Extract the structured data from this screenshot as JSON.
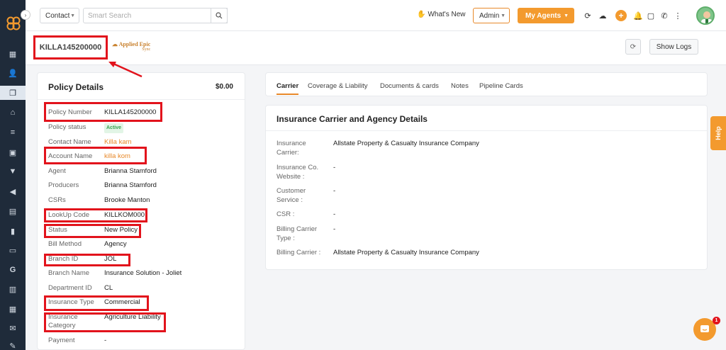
{
  "topbar": {
    "contact_select": "Contact",
    "search_placeholder": "Smart Search",
    "whats_new": "What's New",
    "admin": "Admin",
    "my_agents": "My Agents",
    "notification_count": ""
  },
  "header": {
    "policy_id": "KILLA145200000",
    "brand_name": "Applied Epic",
    "brand_sub": "Sync",
    "show_logs": "Show Logs"
  },
  "policy_details": {
    "title": "Policy Details",
    "amount": "$0.00",
    "fields": [
      {
        "label": "Policy Number",
        "value": "KILLA145200000"
      },
      {
        "label": "Policy status",
        "value": "Active"
      },
      {
        "label": "Contact Name",
        "value": "Killa kam"
      },
      {
        "label": "Account Name",
        "value": "killa kom"
      },
      {
        "label": "Agent",
        "value": "Brianna Stamford"
      },
      {
        "label": "Producers",
        "value": "Brianna Stamford"
      },
      {
        "label": "CSRs",
        "value": "Brooke Manton"
      },
      {
        "label": "LookUp Code",
        "value": "KILLKOM000"
      },
      {
        "label": "Status",
        "value": "New Policy"
      },
      {
        "label": "Bill Method",
        "value": "Agency"
      },
      {
        "label": "Branch ID",
        "value": "JOL"
      },
      {
        "label": "Branch Name",
        "value": "Insurance Solution - Joliet"
      },
      {
        "label": "Department ID",
        "value": "CL"
      },
      {
        "label": "Insurance Type",
        "value": "Commercial"
      },
      {
        "label": "Insurance Category",
        "value": "Agriculture Liability"
      },
      {
        "label": "Payment",
        "value": "-"
      }
    ]
  },
  "tabs": [
    "Carrier",
    "Coverage & Liability",
    "Documents & cards",
    "Notes",
    "Pipeline Cards"
  ],
  "carrier": {
    "title": "Insurance Carrier and Agency Details",
    "fields": [
      {
        "label": "Insurance Carrier:",
        "value": "Allstate Property & Casualty Insurance Company"
      },
      {
        "label": "Insurance Co. Website :",
        "value": "-"
      },
      {
        "label": "Customer Service :",
        "value": "-"
      },
      {
        "label": "CSR :",
        "value": "-"
      },
      {
        "label": "Billing Carrier Type :",
        "value": "-"
      },
      {
        "label": "Billing Carrier :",
        "value": "Allstate Property & Casualty Insurance Company"
      }
    ]
  },
  "help": {
    "label": "Help"
  },
  "chat": {
    "badge": "1"
  },
  "colors": {
    "accent": "#f39a2e",
    "sidebar": "#1f2b3a",
    "highlight": "#e2131c",
    "link": "#e8892a"
  },
  "icons": {
    "sidebar": [
      "dashboard-icon",
      "contacts-icon",
      "policies-icon",
      "bank-icon",
      "list-icon",
      "id-card-icon",
      "filter-icon",
      "megaphone-icon",
      "document-icon",
      "reports-icon",
      "folder-icon",
      "google-icon",
      "calculator-icon",
      "calendar-icon",
      "email-icon",
      "signature-icon"
    ],
    "topbar": [
      "search-icon",
      "refresh-icon",
      "cloud-icon",
      "plus-icon",
      "bell-icon",
      "message-icon",
      "phone-icon",
      "more-icon"
    ]
  }
}
